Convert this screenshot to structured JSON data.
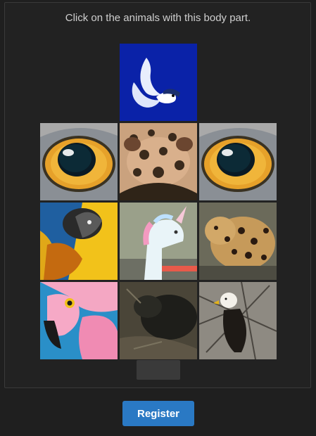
{
  "prompt": "Click on the animals with this body part.",
  "register_label": "Register",
  "reference_tile": {
    "icon": "whale-tail-shape-icon",
    "background": "#0a22a8"
  },
  "grid": [
    {
      "name": "grid-tile-cat-eye-1",
      "icon": "cat-eye-icon"
    },
    {
      "name": "grid-tile-leopard-nose",
      "icon": "spotted-nose-icon"
    },
    {
      "name": "grid-tile-cat-eye-2",
      "icon": "cat-eye-icon"
    },
    {
      "name": "grid-tile-parrot",
      "icon": "macaw-icon"
    },
    {
      "name": "grid-tile-unicorn-float",
      "icon": "unicorn-float-icon"
    },
    {
      "name": "grid-tile-leopard",
      "icon": "leopard-icon"
    },
    {
      "name": "grid-tile-flamingo",
      "icon": "flamingo-icon"
    },
    {
      "name": "grid-tile-dark-animal",
      "icon": "dark-animal-icon"
    },
    {
      "name": "grid-tile-eagle",
      "icon": "eagle-icon"
    }
  ],
  "colors": {
    "background": "#1f1f1f",
    "panel": "#222222",
    "button": "#2a79c4",
    "prompt_text": "#cfcfcf"
  }
}
